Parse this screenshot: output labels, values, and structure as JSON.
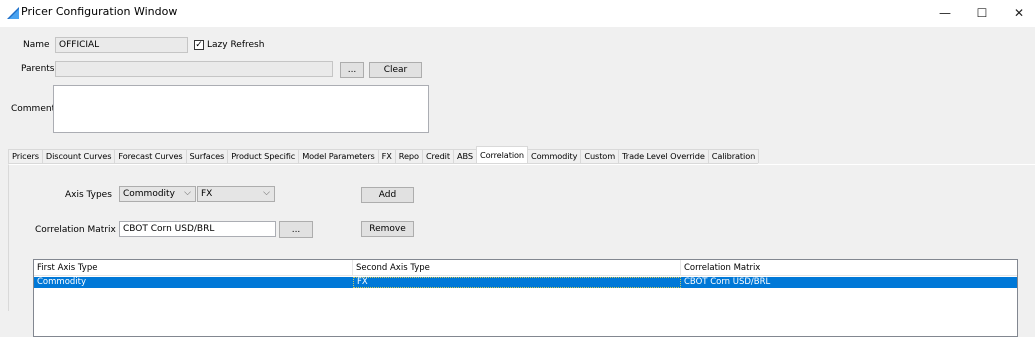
{
  "window": {
    "title": "Pricer Configuration Window",
    "minimize": "—",
    "maximize": "☐",
    "close": "✕"
  },
  "form": {
    "name_label": "Name",
    "name_value": "OFFICIAL",
    "lazy_refresh_label": "Lazy Refresh",
    "lazy_refresh_checked": true,
    "parents_label": "Parents",
    "parents_value": "",
    "parents_browse_label": "...",
    "clear_label": "Clear",
    "comment_label": "Comment",
    "comment_value": ""
  },
  "tabs": [
    {
      "label": "Pricers"
    },
    {
      "label": "Discount Curves"
    },
    {
      "label": "Forecast Curves"
    },
    {
      "label": "Surfaces"
    },
    {
      "label": "Product Specific"
    },
    {
      "label": "Model Parameters"
    },
    {
      "label": "FX"
    },
    {
      "label": "Repo"
    },
    {
      "label": "Credit"
    },
    {
      "label": "ABS"
    },
    {
      "label": "Correlation",
      "active": true
    },
    {
      "label": "Commodity"
    },
    {
      "label": "Custom"
    },
    {
      "label": "Trade Level Override"
    },
    {
      "label": "Calibration"
    }
  ],
  "correlation": {
    "axis_types_label": "Axis Types",
    "axis_type_1": "Commodity",
    "axis_type_2": "FX",
    "add_label": "Add",
    "matrix_label": "Correlation Matrix",
    "matrix_value": "CBOT Corn USD/BRL",
    "matrix_browse_label": "...",
    "remove_label": "Remove",
    "table": {
      "columns": [
        "First Axis Type",
        "Second Axis Type",
        "Correlation Matrix"
      ],
      "rows": [
        [
          "Commodity",
          "FX",
          "CBOT Corn USD/BRL"
        ]
      ]
    }
  },
  "colors": {
    "selection": "#0078d7",
    "background": "#f0f0f0"
  }
}
